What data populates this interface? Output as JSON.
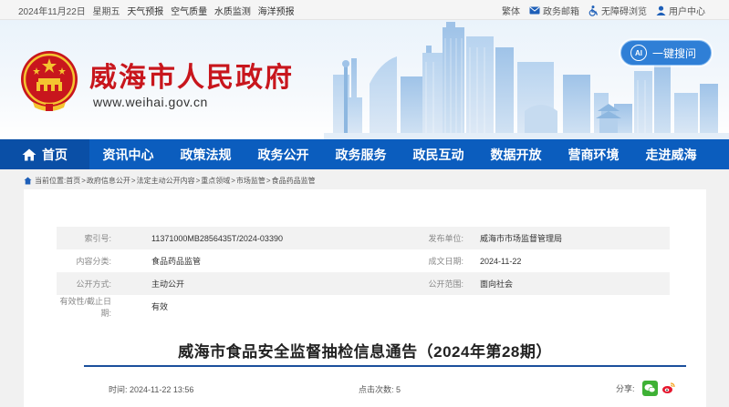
{
  "topbar": {
    "date": "2024年11月22日",
    "weekday": "星期五",
    "links": [
      "天气预报",
      "空气质量",
      "水质监测",
      "海洋预报"
    ],
    "traditional": "繁体",
    "mailbox": "政务邮箱",
    "accessible": "无障碍浏览",
    "user_center": "用户中心"
  },
  "header": {
    "site_title": "威海市人民政府",
    "site_url": "www.weihai.gov.cn",
    "search_label": "一键搜问",
    "ai_badge": "AI"
  },
  "nav": {
    "items": [
      "首页",
      "资讯中心",
      "政策法规",
      "政务公开",
      "政务服务",
      "政民互动",
      "数据开放",
      "营商环境",
      "走进威海"
    ]
  },
  "breadcrumb": {
    "prefix": "当前位置:",
    "items": [
      "首页",
      "政府信息公开",
      "法定主动公开内容",
      "重点领域",
      "市场监管",
      "食品药品监管"
    ],
    "separator": ">"
  },
  "meta": {
    "index_label": "索引号:",
    "index_value": "11371000MB2856435T/2024-03390",
    "publisher_label": "发布单位:",
    "publisher_value": "威海市市场监督管理局",
    "category_label": "内容分类:",
    "category_value": "食品药品监管",
    "date_label": "成文日期:",
    "date_value": "2024-11-22",
    "method_label": "公开方式:",
    "method_value": "主动公开",
    "scope_label": "公开范围:",
    "scope_value": "面向社会",
    "validity_label": "有效性/截止日期:",
    "validity_value": "有效"
  },
  "article": {
    "title": "威海市食品安全监督抽检信息通告（2024年第28期）",
    "time_label": "时间:",
    "time_value": "2024-11-22 13:56",
    "views_label": "点击次数:",
    "views_value": "5",
    "share_label": "分享:"
  },
  "colors": {
    "brand_red": "#c8161d",
    "nav_blue": "#0b5dbe",
    "nav_home": "#0a4fa6",
    "divider": "#1b4f9c"
  },
  "icons": {
    "mail": "mail-icon",
    "accessible": "wheelchair-icon",
    "user": "user-icon",
    "home": "home-icon",
    "location": "location-icon",
    "wechat": "wechat-icon",
    "weibo": "weibo-icon"
  }
}
